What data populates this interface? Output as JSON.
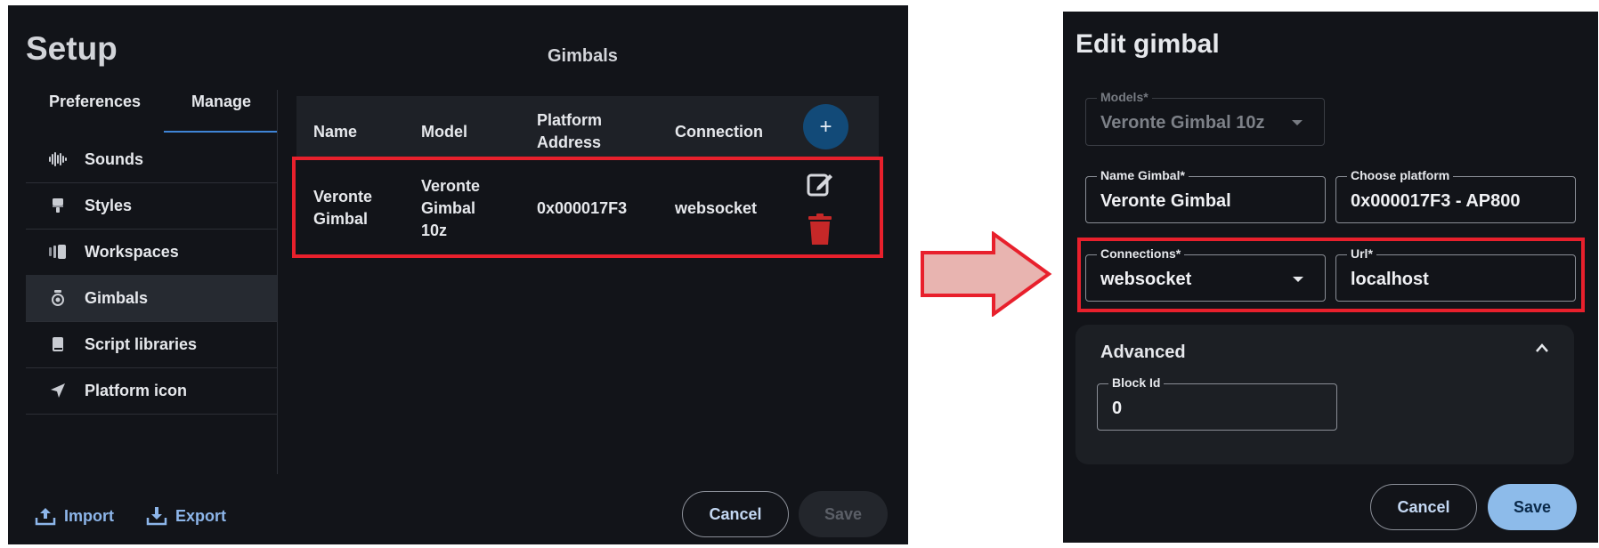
{
  "setup": {
    "title": "Setup",
    "section_title": "Gimbals",
    "tabs": [
      {
        "label": "Preferences"
      },
      {
        "label": "Manage"
      }
    ],
    "sidebar": [
      {
        "label": "Sounds",
        "icon": "waveform-icon"
      },
      {
        "label": "Styles",
        "icon": "paint-brush-icon"
      },
      {
        "label": "Workspaces",
        "icon": "workspace-icon"
      },
      {
        "label": "Gimbals",
        "icon": "gimbal-icon"
      },
      {
        "label": "Script libraries",
        "icon": "book-icon"
      },
      {
        "label": "Platform icon",
        "icon": "location-arrow-icon"
      }
    ],
    "table": {
      "headers": [
        "Name",
        "Model",
        "Platform Address",
        "Connection"
      ],
      "rows": [
        {
          "name": "Veronte Gimbal",
          "model": "Veronte Gimbal 10z",
          "address": "0x000017F3",
          "connection": "websocket"
        }
      ]
    },
    "add_label": "+",
    "import_label": "Import",
    "export_label": "Export",
    "cancel_label": "Cancel",
    "save_label": "Save"
  },
  "edit": {
    "title": "Edit gimbal",
    "models": {
      "label": "Models*",
      "value": "Veronte Gimbal 10z"
    },
    "name": {
      "label": "Name Gimbal*",
      "value": "Veronte Gimbal"
    },
    "platform": {
      "label": "Choose platform",
      "value": "0x000017F3 - AP800"
    },
    "connections": {
      "label": "Connections*",
      "value": "websocket"
    },
    "url": {
      "label": "Url*",
      "value": "localhost"
    },
    "advanced": {
      "title": "Advanced",
      "block_id": {
        "label": "Block Id",
        "value": "0"
      }
    },
    "cancel_label": "Cancel",
    "save_label": "Save"
  },
  "colors": {
    "panel": "#121419",
    "highlight": "#e8202c",
    "accent": "#3f84d6",
    "delete": "#c62828",
    "arrow_fill": "#e8b4b0"
  }
}
